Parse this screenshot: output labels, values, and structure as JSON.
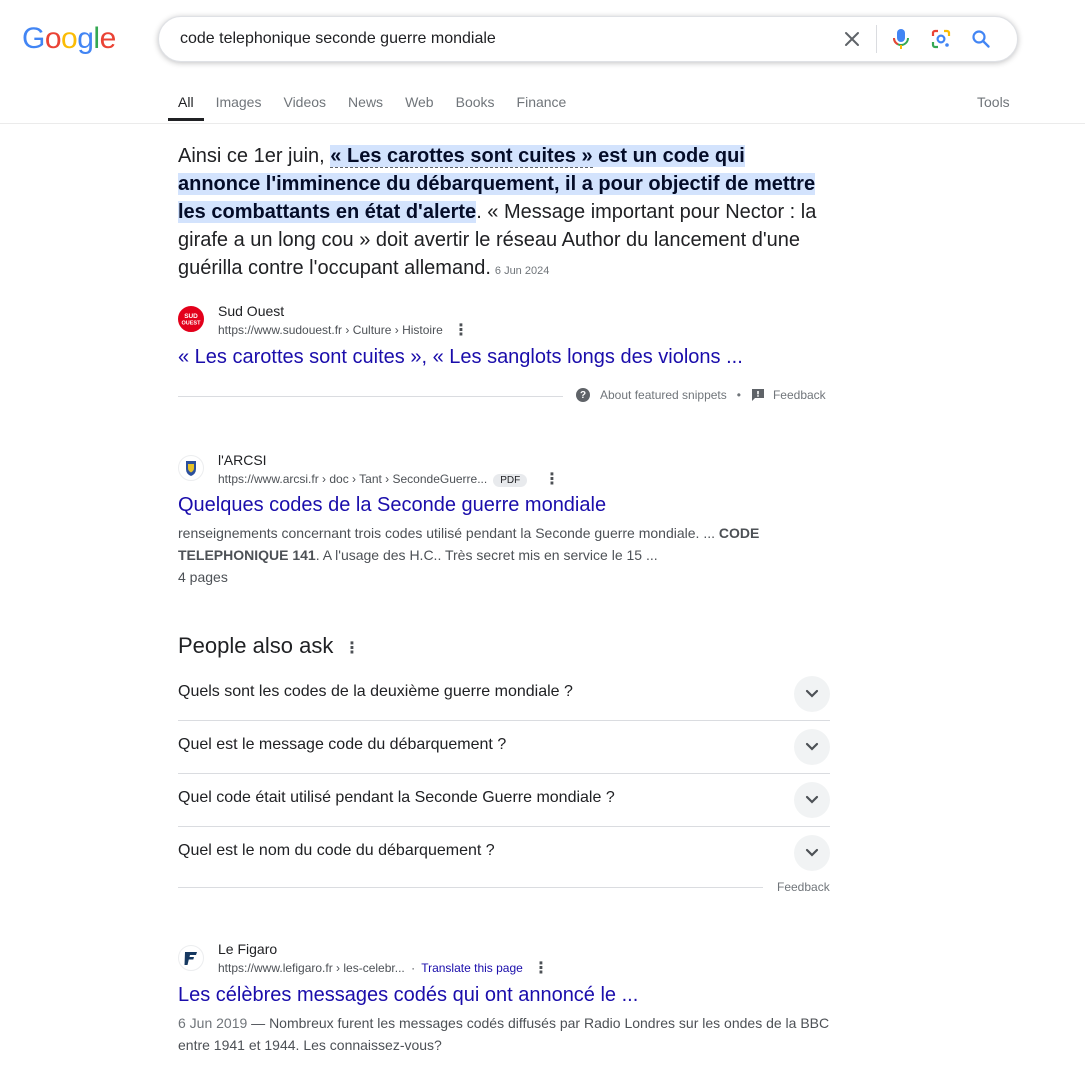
{
  "header": {
    "logo": [
      "G",
      "o",
      "o",
      "g",
      "l",
      "e"
    ],
    "logo_colors": [
      "#4285F4",
      "#EA4335",
      "#FBBC05",
      "#4285F4",
      "#34A853",
      "#EA4335"
    ],
    "query": "code telephonique seconde guerre mondiale"
  },
  "tabs": {
    "items": [
      "All",
      "Images",
      "Videos",
      "News",
      "Web",
      "Books",
      "Finance"
    ],
    "active": "All",
    "tools": "Tools"
  },
  "featured": {
    "lead": "Ainsi ce 1er juin, ",
    "hl_dashed": "« Les carottes sont cuites »",
    "hl_rest": " est un code qui annonce l'imminence du débarquement, il a pour objectif de mettre les combattants en état d'alerte",
    "tail": ". « Message important pour Nector : la girafe a un long cou » doit avertir le réseau Author du lancement d'une guérilla contre l'occupant allemand.",
    "date": "6 Jun 2024",
    "site_name": "Sud Ouest",
    "url": "https://www.sudouest.fr › Culture › Histoire",
    "title": "« Les carottes sont cuites », « Les sanglots longs des violons ...",
    "about_label": "About featured snippets",
    "bullet": "•",
    "feedback_label": "Feedback",
    "favicon_text": [
      "SUD",
      "OUEST"
    ]
  },
  "result_arcsi": {
    "site_name": "l'ARCSI",
    "url": "https://www.arcsi.fr › doc › Tant › SecondeGuerre...",
    "badge": "PDF",
    "title": "Quelques codes de la Seconde guerre mondiale",
    "desc_a": "renseignements concernant trois codes utilisé pendant la Seconde guerre mondiale. ... ",
    "desc_bold": "CODE TELEPHONIQUE 141",
    "desc_b": ". A l'usage des H.C.. Très secret mis en service le 15 ...",
    "pages": "4 pages"
  },
  "paa": {
    "title": "People also ask",
    "questions": [
      "Quels sont les codes de la deuxième guerre mondiale ?",
      "Quel est le message code du débarquement ?",
      "Quel code était utilisé pendant la Seconde Guerre mondiale ?",
      "Quel est le nom du code du débarquement ?"
    ],
    "feedback_label": "Feedback"
  },
  "result_figaro": {
    "site_name": "Le Figaro",
    "url": "https://www.lefigaro.fr › les-celebr...",
    "translate_sep": "·",
    "translate": "Translate this page",
    "title": "Les célèbres messages codés qui ont annoncé le ...",
    "date": "6 Jun 2019",
    "desc": " — Nombreux furent les messages codés diffusés par Radio Londres sur les ondes de la BBC entre 1941 et 1944. Les connaissez-vous?"
  }
}
